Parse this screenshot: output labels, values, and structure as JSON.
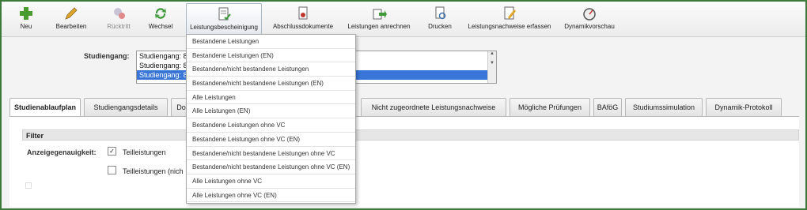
{
  "toolbar": {
    "buttons": [
      {
        "label": "Neu",
        "icon": "plus-icon"
      },
      {
        "label": "Bearbeiten",
        "icon": "pencil-icon"
      },
      {
        "label": "Rücktritt",
        "icon": "withdraw-icon"
      },
      {
        "label": "Wechsel",
        "icon": "refresh-icon"
      },
      {
        "label": "Leistungsbescheinigung",
        "icon": "certificate-icon"
      },
      {
        "label": "Abschlussdokumente",
        "icon": "document-icon"
      },
      {
        "label": "Leistungen anrechnen",
        "icon": "credit-icon"
      },
      {
        "label": "Drucken",
        "icon": "print-icon"
      },
      {
        "label": "Leistungsnachweise erfassen",
        "icon": "record-icon"
      },
      {
        "label": "Dynamikvorschau",
        "icon": "gauge-icon"
      }
    ]
  },
  "menu": {
    "items": [
      "Bestandene Leistungen",
      "Bestandene Leistungen (EN)",
      "Bestandene/nicht bestandene Leistungen",
      "Bestandene/nicht bestandene Leistungen (EN)",
      "Alle Leistungen",
      "Alle Leistungen (EN)",
      "Bestandene Leistungen ohne VC",
      "Bestandene Leistungen ohne VC (EN)",
      "Bestandene/nicht bestandene Leistungen ohne VC",
      "Bestandene/nicht bestandene Leistungen ohne VC (EN)",
      "Alle Leistungen ohne VC",
      "Alle Leistungen ohne VC (EN)"
    ]
  },
  "studiengang": {
    "label": "Studiengang:",
    "options": [
      "Studiengang: 8",
      "Studiengang: 8",
      "Studiengang: 8"
    ],
    "selected_index": 2
  },
  "tabs": [
    "Studienablaufplan",
    "Studiengangsdetails",
    "Do",
    "Nicht zugeordnete Leistungsnachweise",
    "Mögliche Prüfungen",
    "BAföG",
    "Studiumssimulation",
    "Dynamik-Protokoll"
  ],
  "filter": {
    "title": "Filter",
    "anzeige_label": "Anzeigegenauigkeit:",
    "options": [
      {
        "label": "Teilleistungen",
        "checked": true
      },
      {
        "label": "Teilleistungen (nich",
        "checked": false
      }
    ]
  },
  "colors": {
    "frame": "#3c7a3c",
    "selection": "#3875d7"
  }
}
